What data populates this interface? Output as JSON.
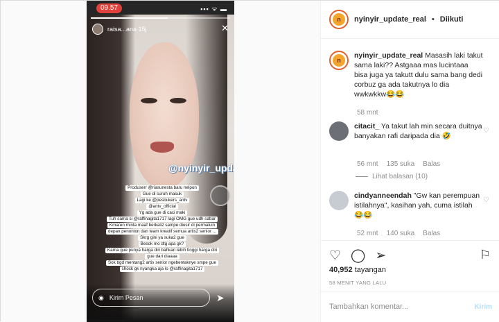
{
  "story": {
    "time": "09.57",
    "signal": "▪▪▪ ᯤ ▬",
    "user_text": "raisa...ana 15j",
    "close": "✕",
    "watermark": "@nyinyir_update_real",
    "overlay_lines": [
      "Produserr @riasunesta baru nelpon",
      "Gue di suruh masuk",
      "Lagi ke @pesbukers_antv",
      "@antv_official",
      "Yg ada gue di caci maki",
      "Tuh sama si @raffinagita1717 lagi OMG gue udh sabar",
      "Kmaren minta maaf berkali2 sampe diusir di permaluin",
      "depan penonton dan team kreatif semua artis2 senior ...",
      "Skrg gini ya suka2 gue",
      "Besok mo dtg apa gk?",
      "Karna gue punya harga diri bahkan lebih tinggi harga diri",
      "gue dari diaaaa",
      "Sok bgd mentang2 artis senior ngebentaknye smpe gue",
      "shock gk nyangka aja lo @raffinagita1717"
    ],
    "message_placeholder": "Kirim Pesan",
    "camera_icon": "◉",
    "send_icon": "➤"
  },
  "header": {
    "avatar_letter": "n",
    "username": "nyinyir_update_real",
    "dot": "•",
    "follow_status": "Diikuti"
  },
  "caption": {
    "username": "nyinyir_update_real",
    "text": "Masasih laki takut sama laki?? Astgaaa mas lucintaaa bisa juga ya takutt dulu sama bang dedi corbuz ga ada takutnya lo dia wwkwkkw😂😂",
    "time": "58 mnt"
  },
  "comments": [
    {
      "username": "citacit_",
      "text": "Ya takut lah min secara duitnya banyakan rafi daripada dia 🤣",
      "time": "56 mnt",
      "likes": "135 suka",
      "reply": "Balas",
      "replies": "Lihat balasan (10)"
    },
    {
      "username": "cindyanneendah",
      "text": "\"Gw kan perempuan istilahnya\", kasihan yah, cuma istilah 😂😂",
      "time": "52 mnt",
      "likes": "140 suka",
      "reply": "Balas"
    }
  ],
  "actions": {
    "views_count": "40,952",
    "views_label": "tayangan",
    "time_ago": "58 MENIT YANG LALU"
  },
  "add_comment": {
    "placeholder": "Tambahkan komentar...",
    "post_label": "Kirim"
  },
  "colors": {
    "accent_link": "#b2dffc",
    "story_time_bg": "#e0413a",
    "avatar_ring": "#e2602f"
  }
}
